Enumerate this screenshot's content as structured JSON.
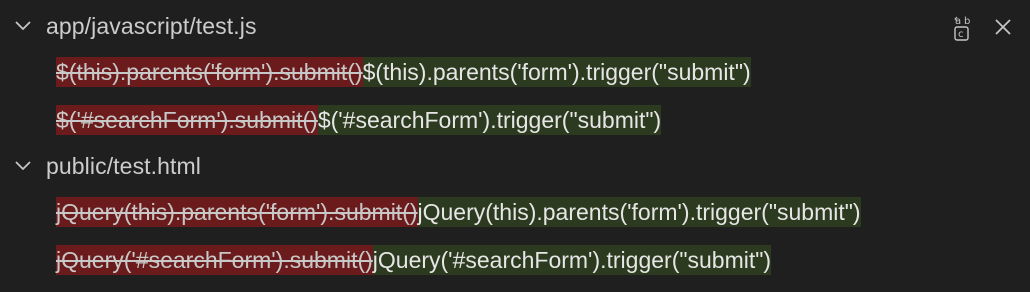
{
  "files": [
    {
      "name": "app/javascript/test.js",
      "matches": [
        {
          "old": "$(this).parents('form').submit()",
          "new": "$(this).parents('form').trigger(\"submit\")"
        },
        {
          "old": "$('#searchForm').submit()",
          "new": "$('#searchForm').trigger(\"submit\")"
        }
      ]
    },
    {
      "name": "public/test.html",
      "matches": [
        {
          "old": "jQuery(this).parents('form').submit()",
          "new": "jQuery(this).parents('form').trigger(\"submit\")"
        },
        {
          "old": "jQuery('#searchForm').submit()",
          "new": "jQuery('#searchForm').trigger(\"submit\")"
        }
      ]
    }
  ],
  "actions": {
    "replace_all_icon": "replace-all-icon",
    "dismiss_icon": "close-icon"
  },
  "colors": {
    "removed_bg": "#6b1b1b",
    "inserted_bg": "#2c3a1f",
    "background": "#1f1f1f"
  }
}
